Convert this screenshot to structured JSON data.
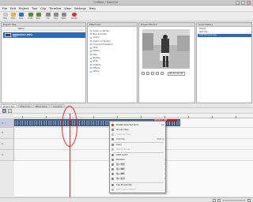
{
  "window": {
    "title": "Untitled / Kdenlive"
  },
  "menubar": {
    "items": [
      "File",
      "Edit",
      "Project",
      "Tool",
      "Clip",
      "Timeline",
      "View",
      "Settings",
      "Help"
    ]
  },
  "toolbar": {
    "buttons": [
      {
        "label": "New",
        "icon": "new-icon",
        "color": "#c9c9c9"
      },
      {
        "label": "Open",
        "icon": "open-folder-icon",
        "color": "#e2b24a"
      },
      {
        "label": "Save",
        "icon": "save-icon",
        "color": "#3a6fb8"
      },
      {
        "label": "Undo",
        "icon": "undo-icon",
        "color": "#5a8a3a"
      },
      {
        "label": "Redo",
        "icon": "redo-icon",
        "color": "#5a8a3a"
      },
      {
        "label": "Cut",
        "icon": "cut-icon",
        "color": "#8a8a8a"
      },
      {
        "label": "Copy",
        "icon": "copy-icon",
        "color": "#8a8a8a"
      },
      {
        "label": "Paste",
        "icon": "paste-icon",
        "color": "#8a8a8a"
      },
      {
        "label": "Render",
        "icon": "render-icon",
        "color": "#d33"
      }
    ]
  },
  "project_tree": {
    "title": "Project Tree",
    "column": "Name",
    "clip": {
      "name": "00004847.MP4",
      "sub": "video"
    }
  },
  "effect_list": {
    "title": "Effect List",
    "items": [
      "Audio correction",
      "Blur and hide",
      "Colour",
      "Colour correction",
      "Crop and transform",
      "Fade",
      "Motion",
      "Misc",
      "Stylize",
      "Tools",
      "Custom",
      "Effects",
      "Filters"
    ]
  },
  "clip_monitor": {
    "title": "Project Monitor",
    "timecode": "00:00:00:00"
  },
  "undo_history": {
    "title": "Undo History",
    "items": [
      "Empty",
      "Add clip",
      "Add timeline clip"
    ]
  },
  "tabs": [
    "Project Tree",
    "Effect List",
    "Effect Stack",
    "Transition"
  ],
  "timeline": {
    "clip_label": "00004847.MP4",
    "track_labels": [
      "V",
      "V",
      "A",
      "A"
    ]
  },
  "context_menu": {
    "items": [
      {
        "label": "Delete Selected Item",
        "shortcut": "Del",
        "disabled": false,
        "icon": "delete-icon",
        "color": "#c33"
      },
      {
        "label": "Group Clips",
        "shortcut": "",
        "disabled": false,
        "icon": "group-icon",
        "color": "#888"
      },
      {
        "label": "Ungroup Clips",
        "shortcut": "",
        "disabled": true,
        "icon": "ungroup-icon",
        "color": "#bbb"
      },
      {
        "label": "Cut Clip",
        "shortcut": "Shift+R",
        "disabled": false,
        "icon": "cut-icon",
        "color": "#888"
      },
      {
        "label": "Copy",
        "shortcut": "",
        "disabled": false,
        "icon": "copy-icon",
        "color": "#888"
      },
      {
        "label": "Paste Effects",
        "shortcut": "",
        "disabled": true,
        "icon": "paste-icon",
        "color": "#bbb"
      },
      {
        "label": "Split Audio",
        "shortcut": "",
        "disabled": false,
        "icon": "split-audio-icon",
        "color": "#888"
      },
      {
        "label": "Markers",
        "shortcut": "",
        "disabled": false,
        "submenu": true,
        "icon": "marker-icon",
        "color": "#888"
      },
      {
        "label": "插入效果",
        "shortcut": "",
        "disabled": false,
        "submenu": true,
        "icon": "effect-icon",
        "color": "#888"
      },
      {
        "label": "插入轉場",
        "shortcut": "",
        "disabled": false,
        "submenu": true,
        "icon": "transition-icon",
        "color": "#888"
      },
      {
        "label": "插入轉場",
        "shortcut": "",
        "disabled": false,
        "submenu": true,
        "icon": "transition-icon",
        "color": "#888"
      },
      {
        "label": "插入軌道",
        "shortcut": "",
        "disabled": false,
        "submenu": true,
        "icon": "track-icon",
        "color": "#888"
      },
      {
        "label": "Clip Properties",
        "shortcut": "",
        "disabled": false,
        "icon": "properties-icon",
        "color": "#888"
      },
      {
        "label": "Edit Custom Effect",
        "shortcut": "",
        "disabled": true,
        "icon": "edit-icon",
        "color": "#bbb"
      }
    ]
  },
  "colors": {
    "selection": "#2b6bbf",
    "clip": "#4d6e94",
    "clip_red": "#c0181e",
    "annotation": "#e1262c"
  }
}
